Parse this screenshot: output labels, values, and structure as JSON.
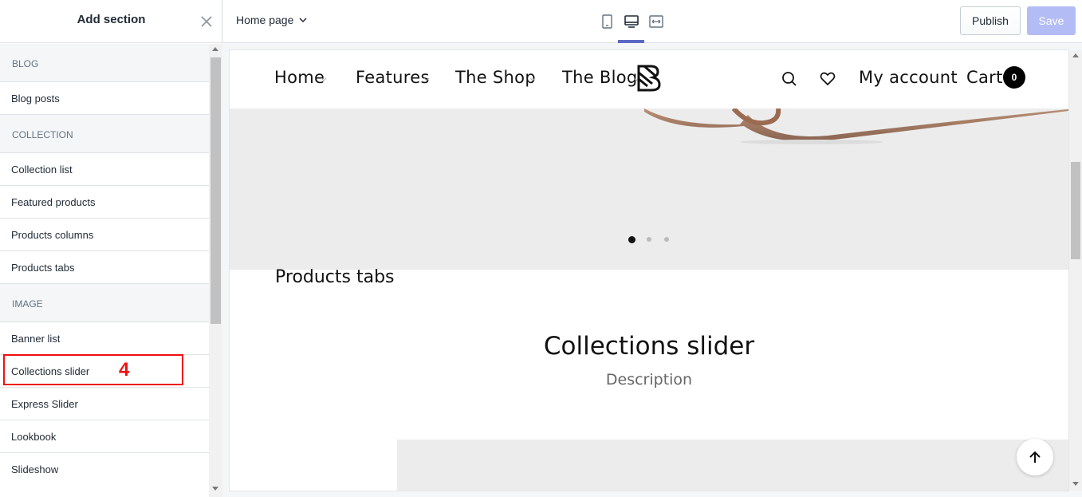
{
  "sidebar": {
    "title": "Add section",
    "groups": [
      {
        "category": "BLOG",
        "items": [
          "Blog posts"
        ]
      },
      {
        "category": "COLLECTION",
        "items": [
          "Collection list",
          "Featured products",
          "Products columns",
          "Products tabs"
        ]
      },
      {
        "category": "IMAGE",
        "items": [
          "Banner list",
          "Collections slider",
          "Express Slider",
          "Lookbook",
          "Slideshow"
        ]
      }
    ],
    "annotation": "4"
  },
  "topbar": {
    "page_select": "Home page",
    "devices": [
      "mobile-icon",
      "desktop-icon",
      "fullscreen-icon"
    ],
    "active_device": "desktop",
    "publish_label": "Publish",
    "save_label": "Save"
  },
  "preview": {
    "nav": {
      "items": [
        "Home",
        "Features",
        "The Shop",
        "The Blog"
      ],
      "my_account": "My account",
      "cart_label": "Cart",
      "cart_count": "0"
    },
    "slider_dots": {
      "count": 3,
      "active": 0
    },
    "products_tabs_label": "Products tabs",
    "collections_title": "Collections slider",
    "collections_description": "Description"
  },
  "colors": {
    "accent": "#5c6ac4",
    "save_disabled": "#b3bcf5",
    "annotation": "#ee1111"
  }
}
